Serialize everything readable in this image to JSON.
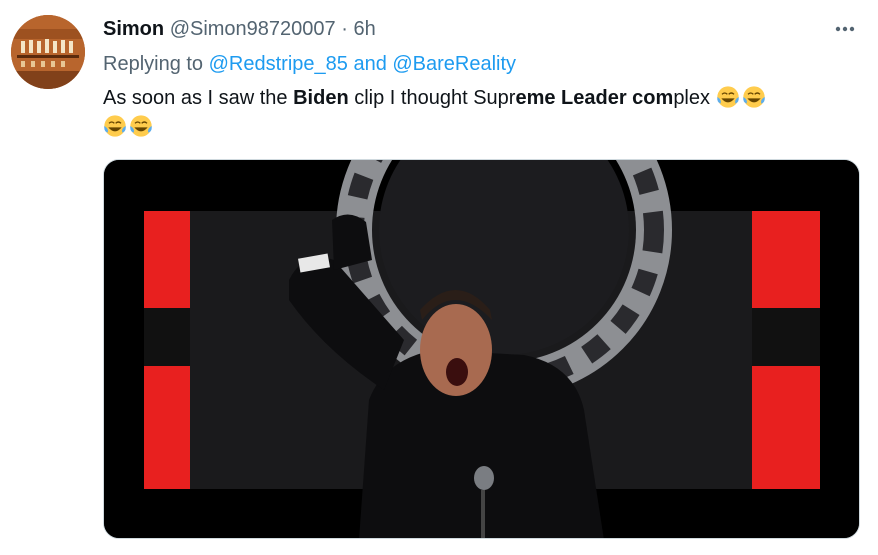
{
  "author": {
    "display_name": "Simon",
    "handle": "@Simon98720007",
    "separator": "·",
    "time": "6h"
  },
  "reply": {
    "prefix": "Replying to",
    "mentions_text": "@Redstripe_85 and @BareReality"
  },
  "tweet": {
    "part1": "As soon as I saw the ",
    "bold1": "Biden",
    "part2": " clip I thought Supr",
    "bold2": "eme Leader com",
    "part3": "plex"
  },
  "icons": {
    "more": "more-horizontal-icon",
    "emoji": "face-with-tears-of-joy-icon"
  },
  "colors": {
    "link": "#1d9bf0",
    "secondary_text": "#536471",
    "banner_red": "#e8201f"
  }
}
